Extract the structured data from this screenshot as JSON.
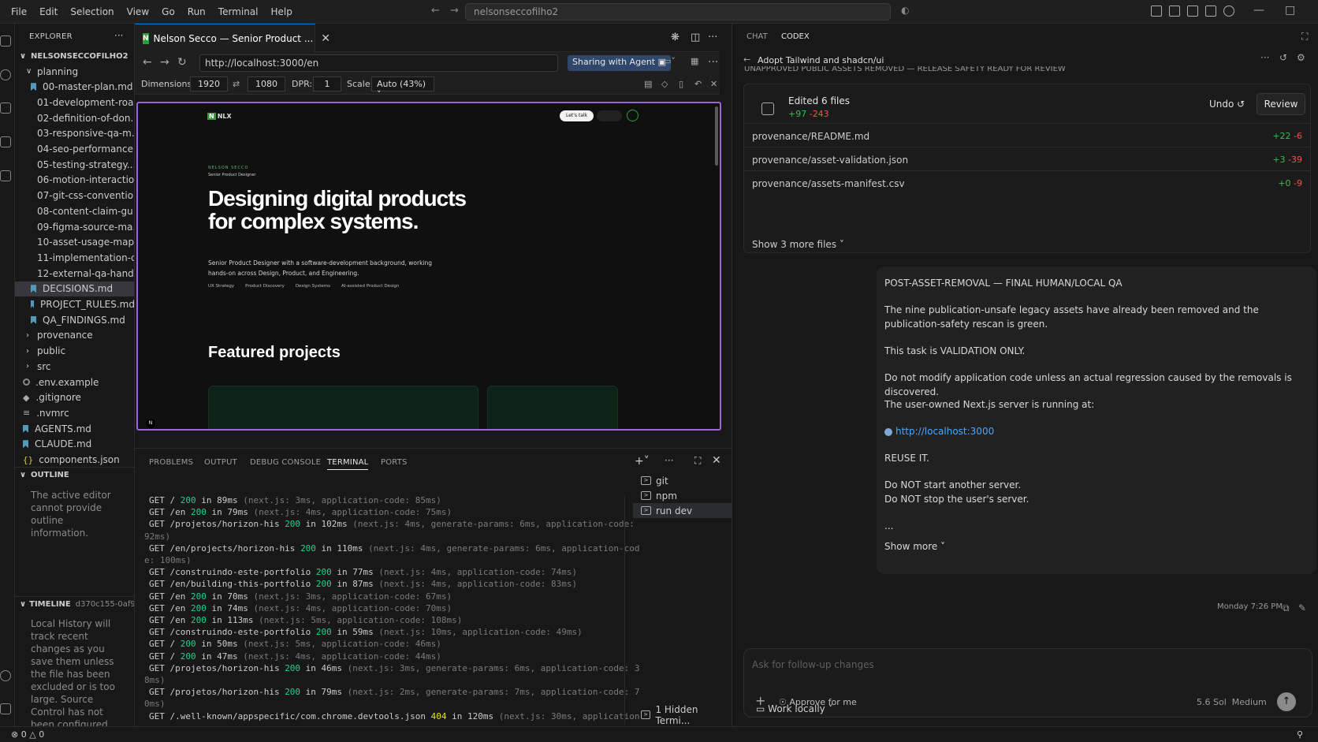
{
  "menubar": {
    "items": [
      "File",
      "Edit",
      "Selection",
      "View",
      "Go",
      "Run",
      "Terminal",
      "Help"
    ],
    "search_text": "nelsonseccofilho2"
  },
  "explorer": {
    "title": "EXPLORER",
    "root": "NELSONSECCOFILHO2",
    "tree": [
      {
        "label": "planning",
        "kind": "folder-open"
      },
      {
        "label": "00-master-plan.md",
        "kind": "md"
      },
      {
        "label": "01-development-roa...",
        "kind": "md"
      },
      {
        "label": "02-definition-of-don...",
        "kind": "md"
      },
      {
        "label": "03-responsive-qa-m...",
        "kind": "md"
      },
      {
        "label": "04-seo-performance...",
        "kind": "md"
      },
      {
        "label": "05-testing-strategy....",
        "kind": "md"
      },
      {
        "label": "06-motion-interactio...",
        "kind": "md"
      },
      {
        "label": "07-git-css-conventio...",
        "kind": "md"
      },
      {
        "label": "08-content-claim-gu...",
        "kind": "md"
      },
      {
        "label": "09-figma-source-ma...",
        "kind": "md"
      },
      {
        "label": "10-asset-usage-map....",
        "kind": "md"
      },
      {
        "label": "11-implementation-c...",
        "kind": "md"
      },
      {
        "label": "12-external-qa-hand...",
        "kind": "md"
      },
      {
        "label": "DECISIONS.md",
        "kind": "md",
        "selected": true
      },
      {
        "label": "PROJECT_RULES.md",
        "kind": "md"
      },
      {
        "label": "QA_FINDINGS.md",
        "kind": "md"
      },
      {
        "label": "provenance",
        "kind": "folder"
      },
      {
        "label": "public",
        "kind": "folder"
      },
      {
        "label": "src",
        "kind": "folder"
      },
      {
        "label": ".env.example",
        "kind": "gear"
      },
      {
        "label": ".gitignore",
        "kind": "git"
      },
      {
        "label": ".nvmrc",
        "kind": "lines"
      },
      {
        "label": "AGENTS.md",
        "kind": "md"
      },
      {
        "label": "CLAUDE.md",
        "kind": "md"
      },
      {
        "label": "components.json",
        "kind": "json"
      }
    ],
    "outline_title": "OUTLINE",
    "outline_text": "The active editor cannot provide outline information.",
    "timeline_title": "TIMELINE",
    "timeline_hash": "d370c155-0af9-...",
    "timeline_text": "Local History will track recent changes as you save them unless the file has been excluded or is too large. Source Control has not been configured."
  },
  "editor_tab": {
    "title": "Nelson Secco — Senior Product ...",
    "favicon_letter": "N"
  },
  "browser": {
    "url": "http://localhost:3000/en",
    "share_label": "Sharing with Agent",
    "dimensions_label": "Dimensions:",
    "width": "1920",
    "height": "1080",
    "dpr_label": "DPR:",
    "dpr": "1",
    "scale_label": "Scale:",
    "scale": "Auto (43%)"
  },
  "site": {
    "logo": "NLX",
    "lets_talk": "Let's talk",
    "kicker": "NELSON SECCO",
    "kicker_role": "Senior Product Designer",
    "hero": "Designing digital products for complex systems.",
    "sub": "Senior Product Designer with a software-development background, working hands-on across Design, Product, and Engineering.",
    "tags": [
      "UX Strategy",
      "Product Discovery",
      "Design Systems",
      "AI-assisted Product Design"
    ],
    "featured": "Featured projects"
  },
  "panel": {
    "tabs": [
      "PROBLEMS",
      "OUTPUT",
      "DEBUG CONSOLE",
      "TERMINAL",
      "PORTS"
    ],
    "active_tab": "TERMINAL",
    "terminals": [
      "git",
      "npm",
      "run dev"
    ],
    "hidden_terminals": "1 Hidden Termi...",
    "log": [
      {
        "pre": "GET / ",
        "code": "200",
        "status": "ok",
        "mid": " in 89ms ",
        "meta": "(next.js: 3ms, application-code: 85ms)"
      },
      {
        "pre": "GET /en ",
        "code": "200",
        "status": "ok",
        "mid": " in 79ms ",
        "meta": "(next.js: 4ms, application-code: 75ms)"
      },
      {
        "pre": "GET /projetos/horizon-his ",
        "code": "200",
        "status": "ok",
        "mid": " in 102ms ",
        "meta": "(next.js: 4ms, generate-params: 6ms, application-code:"
      },
      {
        "pre": "",
        "code": "",
        "status": "",
        "mid": "",
        "meta": "92ms)",
        "indent": true
      },
      {
        "pre": "GET /en/projects/horizon-his ",
        "code": "200",
        "status": "ok",
        "mid": " in 110ms ",
        "meta": "(next.js: 4ms, generate-params: 6ms, application-cod"
      },
      {
        "pre": "",
        "code": "",
        "status": "",
        "mid": "",
        "meta": "e: 100ms)",
        "indent": true
      },
      {
        "pre": "GET /construindo-este-portfolio ",
        "code": "200",
        "status": "ok",
        "mid": " in 77ms ",
        "meta": "(next.js: 4ms, application-code: 74ms)"
      },
      {
        "pre": "GET /en/building-this-portfolio ",
        "code": "200",
        "status": "ok",
        "mid": " in 87ms ",
        "meta": "(next.js: 4ms, application-code: 83ms)"
      },
      {
        "pre": "GET /en ",
        "code": "200",
        "status": "ok",
        "mid": " in 70ms ",
        "meta": "(next.js: 3ms, application-code: 67ms)"
      },
      {
        "pre": "GET /en ",
        "code": "200",
        "status": "ok",
        "mid": " in 74ms ",
        "meta": "(next.js: 4ms, application-code: 70ms)"
      },
      {
        "pre": "GET /en ",
        "code": "200",
        "status": "ok",
        "mid": " in 113ms ",
        "meta": "(next.js: 5ms, application-code: 108ms)"
      },
      {
        "pre": "GET /construindo-este-portfolio ",
        "code": "200",
        "status": "ok",
        "mid": " in 59ms ",
        "meta": "(next.js: 10ms, application-code: 49ms)"
      },
      {
        "pre": "GET / ",
        "code": "200",
        "status": "ok",
        "mid": " in 50ms ",
        "meta": "(next.js: 5ms, application-code: 46ms)"
      },
      {
        "pre": "GET / ",
        "code": "200",
        "status": "ok",
        "mid": " in 47ms ",
        "meta": "(next.js: 4ms, application-code: 44ms)"
      },
      {
        "pre": "GET /projetos/horizon-his ",
        "code": "200",
        "status": "ok",
        "mid": " in 46ms ",
        "meta": "(next.js: 3ms, generate-params: 6ms, application-code: 3"
      },
      {
        "pre": "",
        "code": "",
        "status": "",
        "mid": "",
        "meta": "8ms)",
        "indent": true
      },
      {
        "pre": "GET /projetos/horizon-his ",
        "code": "200",
        "status": "ok",
        "mid": " in 79ms ",
        "meta": "(next.js: 2ms, generate-params: 7ms, application-code: 7"
      },
      {
        "pre": "",
        "code": "",
        "status": "",
        "mid": "",
        "meta": "0ms)",
        "indent": true
      },
      {
        "pre": "GET /.well-known/appspecific/com.chrome.devtools.json ",
        "code": "404",
        "status": "nf",
        "mid": " in 120ms ",
        "meta": "(next.js: 30ms, application"
      }
    ]
  },
  "statusbar": {
    "errors": "0",
    "warnings": "0"
  },
  "chat": {
    "tabs": [
      "CHAT",
      "CODEX"
    ],
    "active_tab": "CODEX",
    "thread_title": "Adopt Tailwind and shadcn/ui",
    "cutoff_line": "UNAPPROVED PUBLIC ASSETS REMOVED — RELEASE SAFETY READY FOR REVIEW",
    "edited_title": "Edited 6 files",
    "edited_add": "+97",
    "edited_del": "-243",
    "undo": "Undo",
    "review": "Review",
    "files": [
      {
        "name": "provenance/README.md",
        "add": "+22",
        "del": "-6"
      },
      {
        "name": "provenance/asset-validation.json",
        "add": "+3",
        "del": "-39"
      },
      {
        "name": "provenance/assets-manifest.csv",
        "add": "+0",
        "del": "-9"
      }
    ],
    "more_files": "Show 3 more files",
    "message": {
      "heading": "POST-ASSET-REMOVAL — FINAL HUMAN/LOCAL QA",
      "p1": "The nine publication-unsafe legacy assets have already been removed and the publication-safety rescan is green.",
      "p2": "This task is VALIDATION ONLY.",
      "p3": "Do not modify application code unless an actual regression caused by the removals is discovered.",
      "p4": "The user-owned Next.js server is running at:",
      "link": "http://localhost:3000",
      "p5": "REUSE IT.",
      "p6": "Do NOT start another server.",
      "p7": "Do NOT stop the user's server.",
      "ellipsis": "...",
      "show_more": "Show more"
    },
    "timestamp": "Monday 7:26 PM",
    "input_placeholder": "Ask for follow-up changes",
    "approve": "Approve for me",
    "model": "5.6 Sol",
    "effort": "Medium",
    "work_locally": "Work locally"
  }
}
